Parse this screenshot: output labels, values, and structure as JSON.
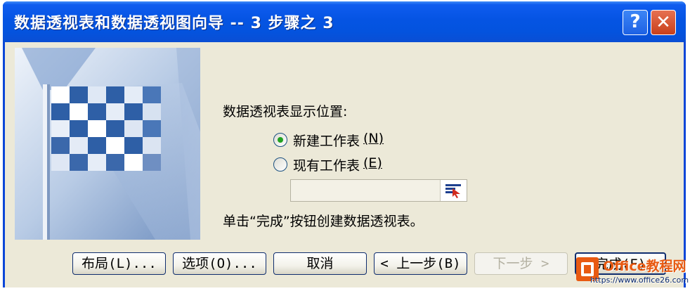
{
  "window": {
    "title": "数据透视表和数据透视图向导 -- 3 步骤之 3",
    "help_label": "?",
    "close_label": "✕"
  },
  "banner": {
    "icon": "checkered-flag-icon"
  },
  "main": {
    "location_label": "数据透视表显示位置:",
    "radio_new_sheet": {
      "label": "新建工作表",
      "mnemonic": "N",
      "checked": true
    },
    "radio_existing_sheet": {
      "label": "现有工作表",
      "mnemonic": "E",
      "checked": false
    },
    "reference_value": "",
    "instruction": "单击“完成”按钮创建数据透视表。"
  },
  "buttons": {
    "layout": "布局(L)...",
    "options": "选项(O)...",
    "cancel": "取消",
    "back": "< 上一步(B)",
    "next": "下一步 >",
    "finish": "完成(F)"
  },
  "watermark": {
    "brand": "Office教程网",
    "url": "https://www.office26.com"
  },
  "colors": {
    "titlebar": "#0554e3",
    "client_bg": "#ece9d8",
    "radio_dot": "#21a121",
    "close_button": "#c9401b",
    "watermark_orange": "#e85a12"
  }
}
